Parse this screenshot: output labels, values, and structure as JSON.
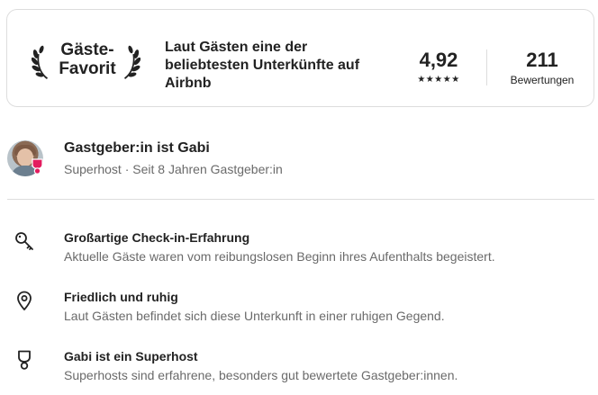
{
  "guest_favorite": {
    "badge_line1": "Gäste-",
    "badge_line2": "Favorit",
    "description": "Laut Gästen eine der beliebtesten Unterkünfte auf Airbnb",
    "rating": "4,92",
    "stars": "★★★★★",
    "reviews_count": "211",
    "reviews_label": "Bewertungen"
  },
  "host": {
    "title": "Gastgeber:in ist Gabi",
    "subtitle": "Superhost · Seit 8 Jahren Gastgeber:in"
  },
  "features": [
    {
      "icon": "key-icon",
      "title": "Großartige Check-in-Erfahrung",
      "description": "Aktuelle Gäste waren vom reibungslosen Beginn ihres Aufenthalts begeistert."
    },
    {
      "icon": "location-pin-icon",
      "title": "Friedlich und ruhig",
      "description": "Laut Gästen befindet sich diese Unterkunft in einer ruhigen Gegend."
    },
    {
      "icon": "superhost-medal-icon",
      "title": "Gabi ist ein Superhost",
      "description": "Superhosts sind erfahrene, besonders gut bewertete Gastgeber:innen."
    }
  ],
  "colors": {
    "text_primary": "#222222",
    "text_secondary": "#6a6a6a",
    "border": "#dddddd",
    "superhost_badge": "#e31c5f"
  }
}
